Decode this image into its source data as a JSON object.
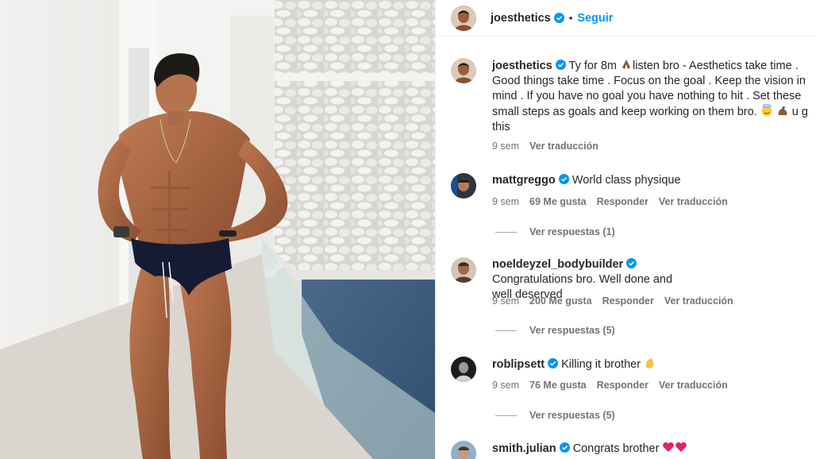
{
  "post": {
    "username": "joesthetics",
    "dot": "•",
    "follow_label": "Seguir",
    "caption": {
      "username": "joesthetics",
      "text_1": "Ty for 8m",
      "text_2": "listen bro - Aesthetics take time . Good things take time . Focus on the goal . Keep the vision in mind . If you have no goal you have nothing to hit . Set these small steps as goals and keep working on them bro.",
      "text_3": "u g",
      "text_4": "this",
      "time": "9 sem",
      "translate": "Ver traducción"
    }
  },
  "comments": [
    {
      "username": "mattgreggo",
      "text": "World class physique",
      "time": "9 sem",
      "likes": "69 Me gusta",
      "reply": "Responder",
      "translate": "Ver traducción",
      "replies": "Ver respuestas (1)"
    },
    {
      "username": "noeldeyzel_bodybuilder",
      "text_1": "Congratulations bro. Well done and",
      "text_2": "well deserved",
      "time": "9 sem",
      "likes": "200 Me gusta",
      "reply": "Responder",
      "translate": "Ver traducción",
      "replies": "Ver respuestas (5)"
    },
    {
      "username": "roblipsett",
      "text": "Killing it brother",
      "time": "9 sem",
      "likes": "76 Me gusta",
      "reply": "Responder",
      "translate": "Ver traducción",
      "replies": "Ver respuestas (5)"
    },
    {
      "username": "smith.julian",
      "text": "Congrats brother"
    }
  ],
  "colors": {
    "link": "#0095f6",
    "muted": "#737373",
    "verified": "#0095f6",
    "heart": "#e0245e"
  },
  "icons": [
    "verified-badge-icon",
    "praying-hands-emoji",
    "smiling-halo-emoji",
    "flexed-biceps-emoji",
    "clapping-hands-emoji",
    "red-heart-emoji"
  ]
}
